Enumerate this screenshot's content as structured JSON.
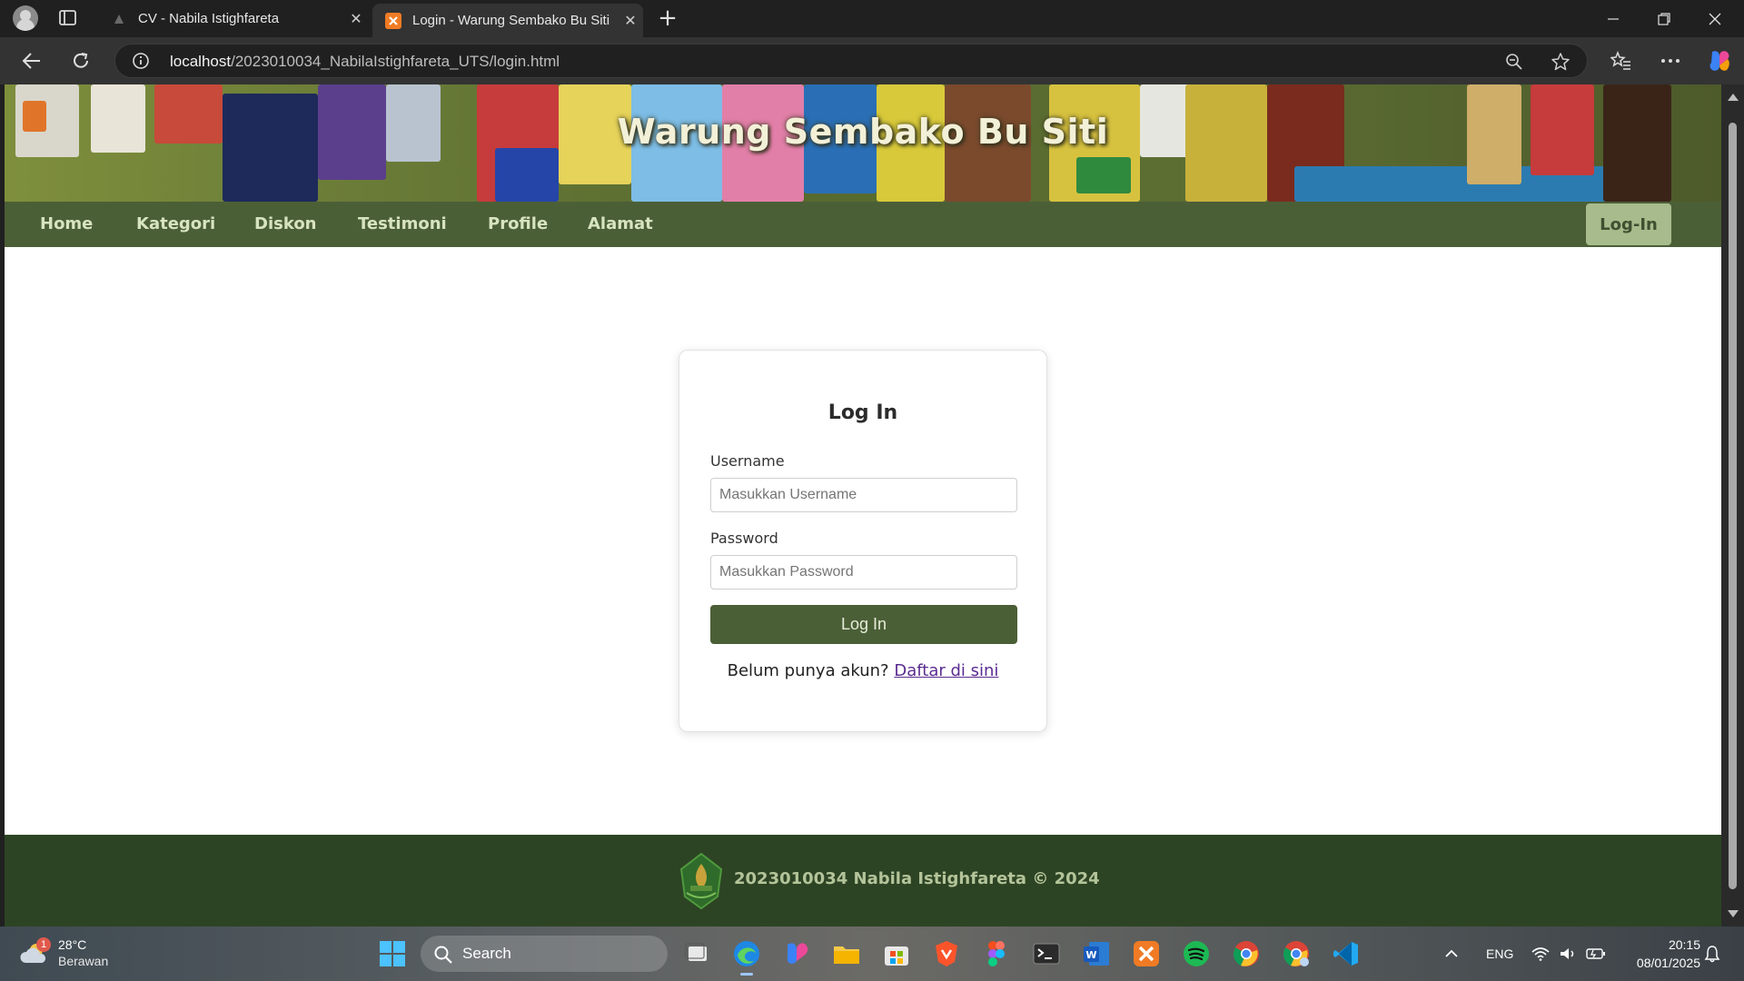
{
  "browser": {
    "tabs": [
      {
        "title": "CV - Nabila Istighfareta",
        "active": false
      },
      {
        "title": "Login - Warung Sembako Bu Siti",
        "active": true
      }
    ],
    "url_host": "localhost",
    "url_path": "/2023010034_NabilaIstighfareta_UTS/login.html"
  },
  "site": {
    "title": "Warung Sembako Bu Siti",
    "nav": {
      "items": [
        "Home",
        "Kategori",
        "Diskon",
        "Testimoni",
        "Profile",
        "Alamat"
      ],
      "login_label": "Log-In"
    },
    "login_card": {
      "heading": "Log In",
      "username_label": "Username",
      "username_placeholder": "Masukkan Username",
      "password_label": "Password",
      "password_placeholder": "Masukkan Password",
      "submit_label": "Log In",
      "register_prompt": "Belum punya akun?",
      "register_link": "Daftar di sini"
    },
    "footer": {
      "text": "2023010034 Nabila Istighfareta © 2024"
    },
    "colors": {
      "primary_green": "#4b5f37",
      "footer_green": "#2d4424",
      "login_button_bg": "#a7bb8c",
      "link_purple": "#5a2c91"
    }
  },
  "taskbar": {
    "weather": {
      "temp": "28°C",
      "condition": "Berawan",
      "badge": "1"
    },
    "search_label": "Search",
    "apps": [
      "task-view",
      "edge",
      "copilot",
      "file-explorer",
      "microsoft-store",
      "brave",
      "figma",
      "terminal",
      "word",
      "xampp",
      "spotify",
      "chrome",
      "chrome-profile",
      "vscode"
    ],
    "tray": {
      "language": "ENG"
    },
    "clock": {
      "time": "20:15",
      "date": "08/01/2025"
    }
  }
}
